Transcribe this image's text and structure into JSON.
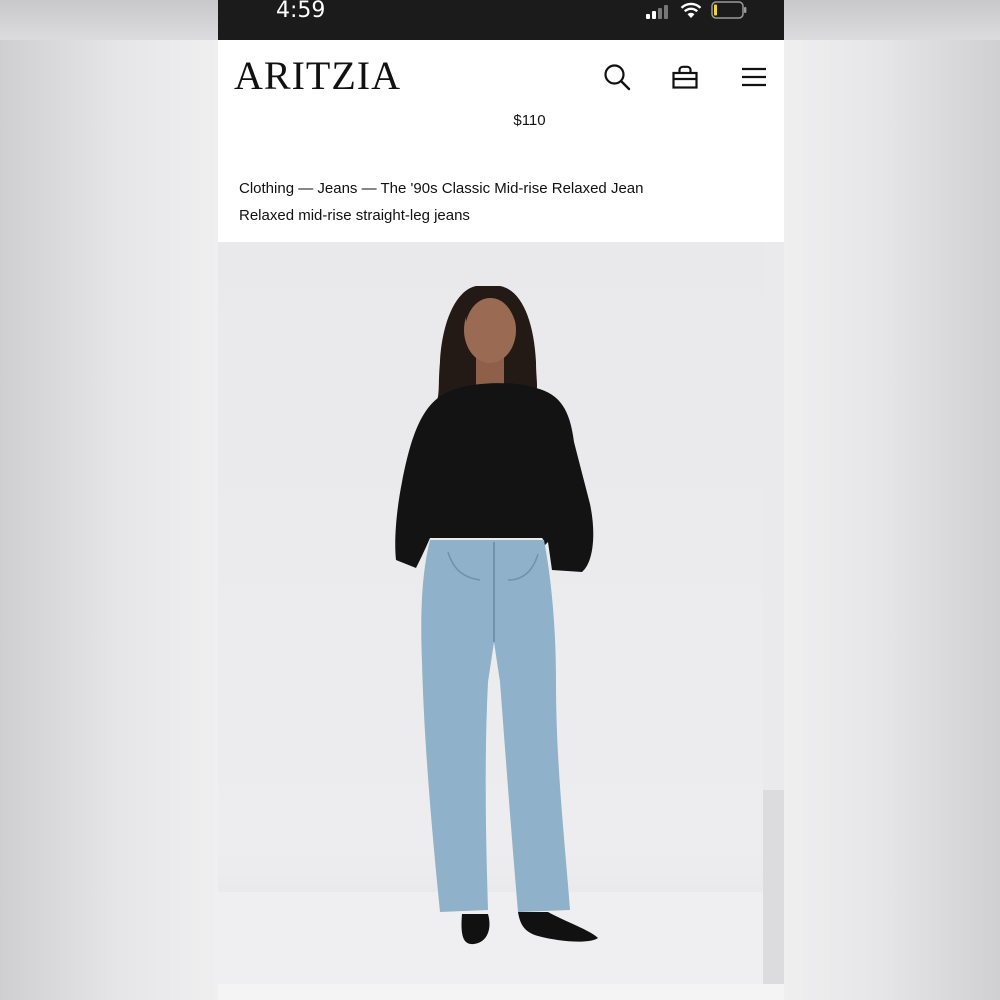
{
  "status_bar": {
    "time": "4:59"
  },
  "header": {
    "logo": "ARITZIA"
  },
  "icons": {
    "search": "search-icon",
    "bag": "shopping-bag-icon",
    "menu": "hamburger-menu-icon"
  },
  "product": {
    "price": "$110",
    "breadcrumb": {
      "level1": "Clothing",
      "level2": "Jeans",
      "level3": "The '90s Classic Mid-rise Relaxed Jean",
      "separator": " — "
    },
    "subtitle": "Relaxed mid-rise straight-leg jeans"
  },
  "colors": {
    "sweater": "#131313",
    "denim": "#8fb1c9",
    "skin": "#9a6a52",
    "hair": "#231915"
  }
}
